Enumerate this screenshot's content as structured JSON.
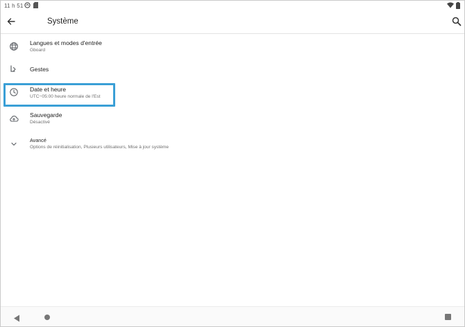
{
  "status_bar": {
    "time": "11 h 51",
    "icons": [
      "sync-circle-icon",
      "sd-card-icon",
      "wifi-icon",
      "battery-icon"
    ]
  },
  "app_bar": {
    "title": "Système",
    "back_icon": "arrow-back-icon",
    "search_icon": "search-icon"
  },
  "items": [
    {
      "title": "Langues et modes d'entrée",
      "subtitle": "Gboard",
      "icon": "globe-icon"
    },
    {
      "title": "Gestes",
      "subtitle": "",
      "icon": "gesture-icon"
    },
    {
      "title": "Date et heure",
      "subtitle": "UTC−05:00 heure normale de l'Est",
      "icon": "clock-icon",
      "highlighted": true
    },
    {
      "title": "Sauvegarde",
      "subtitle": "Désactivé",
      "icon": "cloud-backup-icon"
    },
    {
      "title": "Avancé",
      "subtitle": "Options de réinitialisation, Plusieurs utilisateurs, Mise à jour système",
      "icon": "chevron-down-icon"
    }
  ],
  "nav_bar": {
    "icons": [
      "nav-back-icon",
      "nav-home-icon",
      "nav-recent-icon"
    ]
  },
  "colors": {
    "highlight": "#3a9fd6",
    "text_primary": "#222222",
    "text_secondary": "#6f6f6f",
    "icon": "#5f6368"
  }
}
